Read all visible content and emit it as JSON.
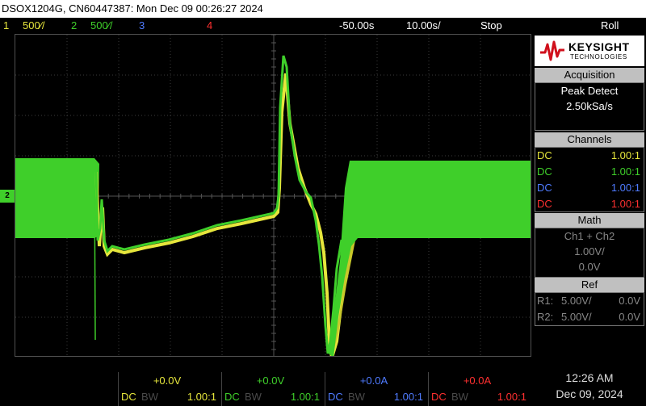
{
  "title_bar": {
    "text": "DSOX1204G, CN60447387: Mon Dec 09 00:26:27 2024"
  },
  "status_bar": {
    "ch1_label": "1",
    "ch1_scale": "500⁄/",
    "ch2_label": "2",
    "ch2_scale": "500⁄/",
    "ch3_label": "3",
    "ch4_label": "4",
    "time_offset": "-50.00s",
    "time_scale": "10.00s/",
    "run_state": "Stop",
    "mode": "Roll"
  },
  "ground_marker": {
    "label": "2"
  },
  "logo": {
    "brand": "KEYSIGHT",
    "sub": "TECHNOLOGIES"
  },
  "acquisition": {
    "header": "Acquisition",
    "mode": "Peak Detect",
    "rate": "2.50kSa/s"
  },
  "channels_panel": {
    "header": "Channels",
    "rows": [
      {
        "coupling": "DC",
        "probe": "1.00:1",
        "color": "#e6e63c"
      },
      {
        "coupling": "DC",
        "probe": "1.00:1",
        "color": "#3fcf2a"
      },
      {
        "coupling": "DC",
        "probe": "1.00:1",
        "color": "#4f7bff"
      },
      {
        "coupling": "DC",
        "probe": "1.00:1",
        "color": "#ff3030"
      }
    ]
  },
  "math": {
    "header": "Math",
    "function": "Ch1 + Ch2",
    "scale": "1.00V/",
    "offset": "0.0V"
  },
  "ref": {
    "header": "Ref",
    "r1_label": "R1:",
    "r1_scale": "5.00V/",
    "r1_offset": "0.0V",
    "r2_label": "R2:",
    "r2_scale": "5.00V/",
    "r2_offset": "0.0V"
  },
  "bottom_channels": [
    {
      "offset": "+0.0V",
      "coupling": "DC",
      "bw": "BW",
      "probe": "1.00:1",
      "color": "#e6e63c"
    },
    {
      "offset": "+0.0V",
      "coupling": "DC",
      "bw": "BW",
      "probe": "1.00:1",
      "color": "#3fcf2a"
    },
    {
      "offset": "+0.0A",
      "coupling": "DC",
      "bw": "BW",
      "probe": "1.00:1",
      "color": "#4f7bff"
    },
    {
      "offset": "+0.0A",
      "coupling": "DC",
      "bw": "BW",
      "probe": "1.00:1",
      "color": "#ff3030"
    }
  ],
  "clock": {
    "time": "12:26 AM",
    "date": "Dec 09, 2024"
  },
  "colors": {
    "ch1": "#e6e63c",
    "ch2": "#3fcf2a",
    "ch3": "#4f7bff",
    "ch4": "#ff3030",
    "marker": "#e89a3a",
    "grid": "#3c3c3c"
  }
}
